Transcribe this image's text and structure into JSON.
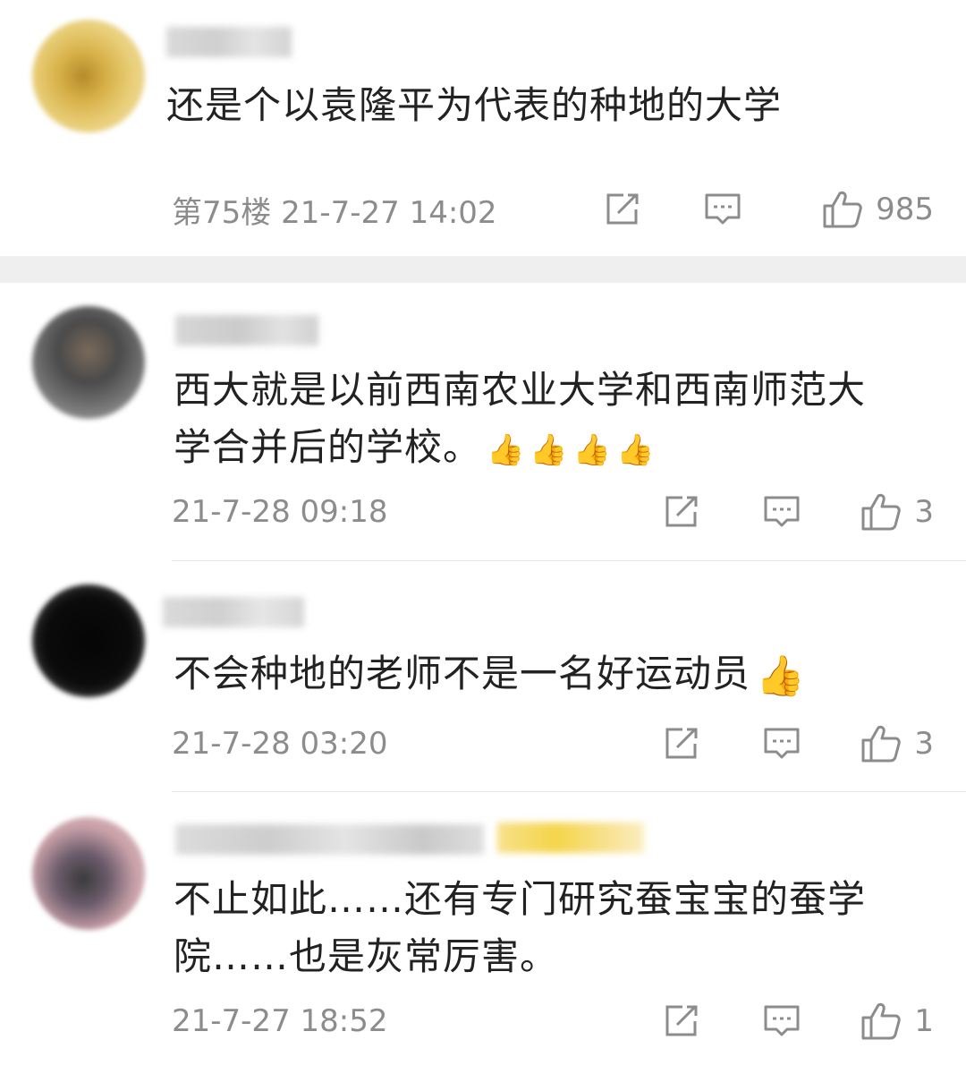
{
  "comments": [
    {
      "floor": "第75楼",
      "time": "21-7-27 14:02",
      "text_lines": [
        "还是个以袁隆平为代表的种地的大学"
      ],
      "emoji": "",
      "likes": "985"
    },
    {
      "floor": "",
      "time": "21-7-28 09:18",
      "text_lines": [
        "西大就是以前西南农业大学和西南师范大",
        "学合并后的学校。"
      ],
      "emoji": "👍👍👍👍",
      "likes": "3"
    },
    {
      "floor": "",
      "time": "21-7-28 03:20",
      "text_lines": [
        "不会种地的老师不是一名好运动员"
      ],
      "emoji": "👍",
      "likes": "3"
    },
    {
      "floor": "",
      "time": "21-7-27 18:52",
      "text_lines": [
        "不止如此……还有专门研究蚕宝宝的蚕学",
        "院……也是灰常厉害。"
      ],
      "emoji": "",
      "likes": "1"
    }
  ],
  "icons": {
    "share": "share-icon",
    "reply": "reply-icon",
    "like": "thumb-up-icon"
  },
  "colors": {
    "text": "#222222",
    "meta": "#8c8c8c",
    "divider": "#efefef"
  }
}
